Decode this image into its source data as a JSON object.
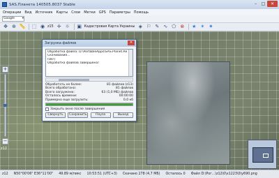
{
  "window": {
    "title": "SAS.Планета 140505.8037 Stable"
  },
  "menu": [
    "Операции",
    "Вид",
    "Источник",
    "Карты",
    "Слои",
    "Метки",
    "GPS",
    "Параметры",
    "Помощь"
  ],
  "search": {
    "value": "Google"
  },
  "toolbar": {
    "zoom": "z15",
    "map_name": "Кадастровая Карта Украины"
  },
  "zoom_level": "z12",
  "dialog": {
    "title": "Загрузка файлов",
    "log": [
      "Обработка файла: D:\\PortableApps\\SAS.Planet.Release...",
      "Скачивание...",
      "(Ok!)",
      "Обработка файлов завершена!"
    ],
    "stats": [
      {
        "label": "Обработать не более:",
        "value": "81 файлов (z13)"
      },
      {
        "label": "Всего обработано:",
        "value": "81 файлов"
      },
      {
        "label": "Всего загружено:",
        "value": "63 (1,0 МБ) файлов"
      },
      {
        "label": "Осталось времени:",
        "value": "00:00:00"
      },
      {
        "label": "Примерно еще загрузить:",
        "value": "0,0 кб"
      }
    ],
    "progress_percent": 100,
    "checkbox_label": "Закрыть окно после завершения",
    "buttons": [
      "Свернуть",
      "Сохранить",
      "Пауза",
      "Выход"
    ]
  },
  "statusbar": {
    "zoom": "z12",
    "coords": "N50°00'06\" E36°11'00\"",
    "scale": "49.89 м/пикс",
    "time": "10:53:51 (UTC+3)",
    "downloaded": "Скачано 278 (4,7 МБ)",
    "remaining": "Осталось 0",
    "file": "Файл D:\\Рог...\\z12\\0\\x1223\\0\\y690.png"
  }
}
